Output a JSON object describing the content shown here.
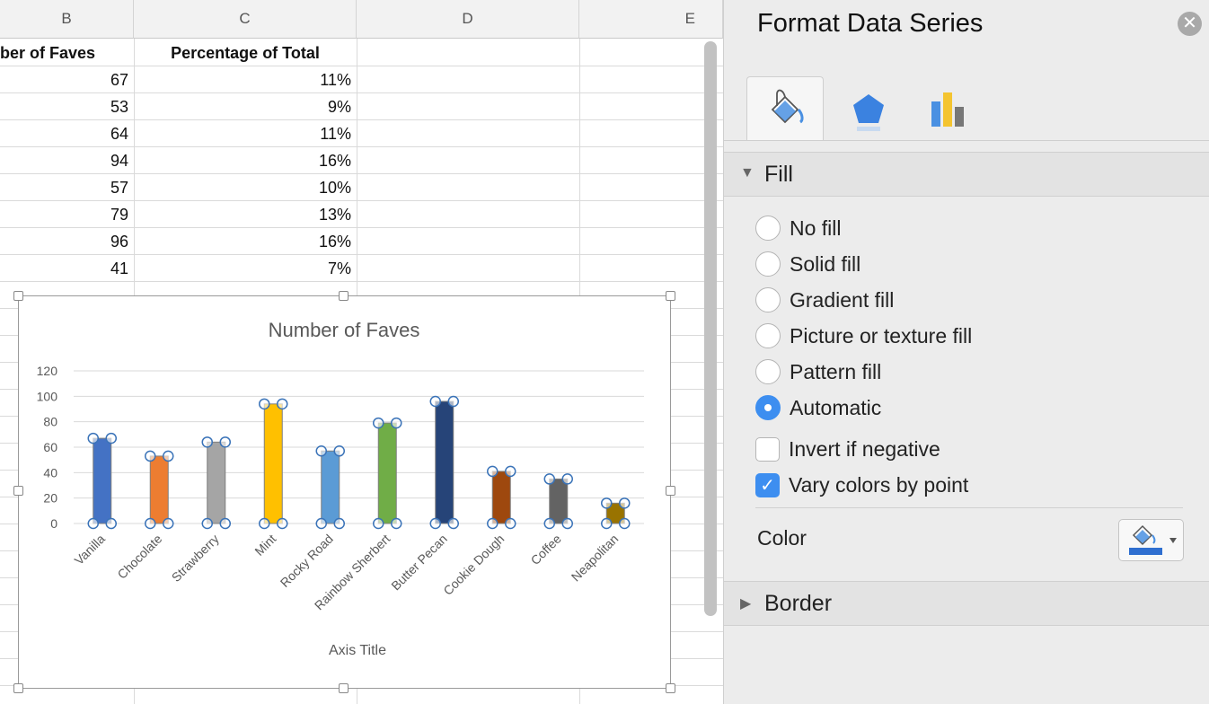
{
  "sheet": {
    "columns": [
      "B",
      "C",
      "D",
      "E"
    ],
    "headers": {
      "b": "ber of Faves",
      "c": "Percentage of Total"
    },
    "rows": [
      {
        "b": "67",
        "c": "11%"
      },
      {
        "b": "53",
        "c": "9%"
      },
      {
        "b": "64",
        "c": "11%"
      },
      {
        "b": "94",
        "c": "16%"
      },
      {
        "b": "57",
        "c": "10%"
      },
      {
        "b": "79",
        "c": "13%"
      },
      {
        "b": "96",
        "c": "16%"
      },
      {
        "b": "41",
        "c": "7%"
      }
    ]
  },
  "chart_data": {
    "type": "bar",
    "title": "Number of Faves",
    "xlabel": "Axis Title",
    "ylabel": "",
    "ylim": [
      0,
      120
    ],
    "yticks": [
      "0",
      "20",
      "40",
      "60",
      "80",
      "100",
      "120"
    ],
    "grid": true,
    "categories": [
      "Vanilla",
      "Chocolate",
      "Strawberry",
      "Mint",
      "Rocky Road",
      "Rainbow Sherbert",
      "Butter Pecan",
      "Cookie Dough",
      "Coffee",
      "Neapolitan"
    ],
    "values": [
      67,
      53,
      64,
      94,
      57,
      79,
      96,
      41,
      35,
      16
    ],
    "colors": [
      "#4472c4",
      "#ed7d31",
      "#a5a5a5",
      "#ffc000",
      "#5b9bd5",
      "#70ad47",
      "#264478",
      "#9e480e",
      "#636363",
      "#997300"
    ]
  },
  "panel": {
    "title": "Format Data Series",
    "close_icon": "close-icon",
    "tabs": [
      {
        "name": "fill-line-tab",
        "icon": "paint-bucket-icon"
      },
      {
        "name": "effects-tab",
        "icon": "pentagon-icon"
      },
      {
        "name": "series-options-tab",
        "icon": "bar-chart-icon"
      }
    ],
    "fill_section": "Fill",
    "fill_options": [
      {
        "label": "No fill",
        "selected": false
      },
      {
        "label": "Solid fill",
        "selected": false
      },
      {
        "label": "Gradient fill",
        "selected": false
      },
      {
        "label": "Picture or texture fill",
        "selected": false
      },
      {
        "label": "Pattern fill",
        "selected": false
      },
      {
        "label": "Automatic",
        "selected": true
      }
    ],
    "invert_label": "Invert if negative",
    "invert_checked": false,
    "vary_label": "Vary colors by point",
    "vary_checked": true,
    "color_label": "Color",
    "border_section": "Border",
    "accent_color": "#3d8ef0"
  }
}
